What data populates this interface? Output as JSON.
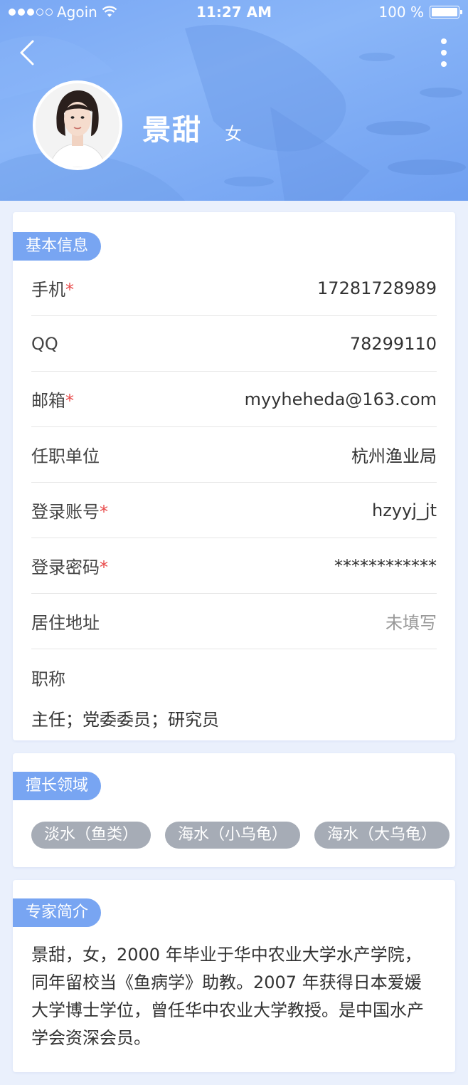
{
  "status_bar": {
    "carrier": "Agoin",
    "time": "11:27 AM",
    "battery": "100 %"
  },
  "header": {
    "name": "景甜",
    "gender": "女"
  },
  "basic_info": {
    "tag": "基本信息",
    "rows": [
      {
        "label": "手机",
        "required": "*",
        "value": "17281728989"
      },
      {
        "label": "QQ",
        "required": "",
        "value": "78299110"
      },
      {
        "label": "邮箱",
        "required": "*",
        "value": "myyheheda@163.com"
      },
      {
        "label": "任职单位",
        "required": "",
        "value": "杭州渔业局"
      },
      {
        "label": "登录账号",
        "required": "*",
        "value": "hzyyj_jt"
      },
      {
        "label": "登录密码",
        "required": "*",
        "value": "************"
      },
      {
        "label": "居住地址",
        "required": "",
        "value": "未填写"
      }
    ],
    "title_label": "职称",
    "title_value": "主任；党委委员；研究员"
  },
  "expertise": {
    "tag": "擅长领域",
    "chips": [
      "淡水（鱼类）",
      "海水（小乌龟）",
      "海水（大乌龟）"
    ]
  },
  "intro": {
    "tag": "专家简介",
    "text": "景甜，女，2000 年毕业于华中农业大学水产学院，同年留校当《鱼病学》助教。2007 年获得日本爱媛大学博士学位，曾任华中农业大学教授。是中国水产学会资深会员。"
  },
  "colors": {
    "header_bg": "#7aa8f4",
    "tag_bg": "#78a5f2",
    "chip_bg": "#a6acb6",
    "required": "#e84a4a",
    "page_bg": "#eaf0fc"
  },
  "icons": [
    "back-arrow-icon",
    "more-vertical-icon",
    "wifi-icon",
    "battery-icon",
    "signal-dots-icon"
  ]
}
